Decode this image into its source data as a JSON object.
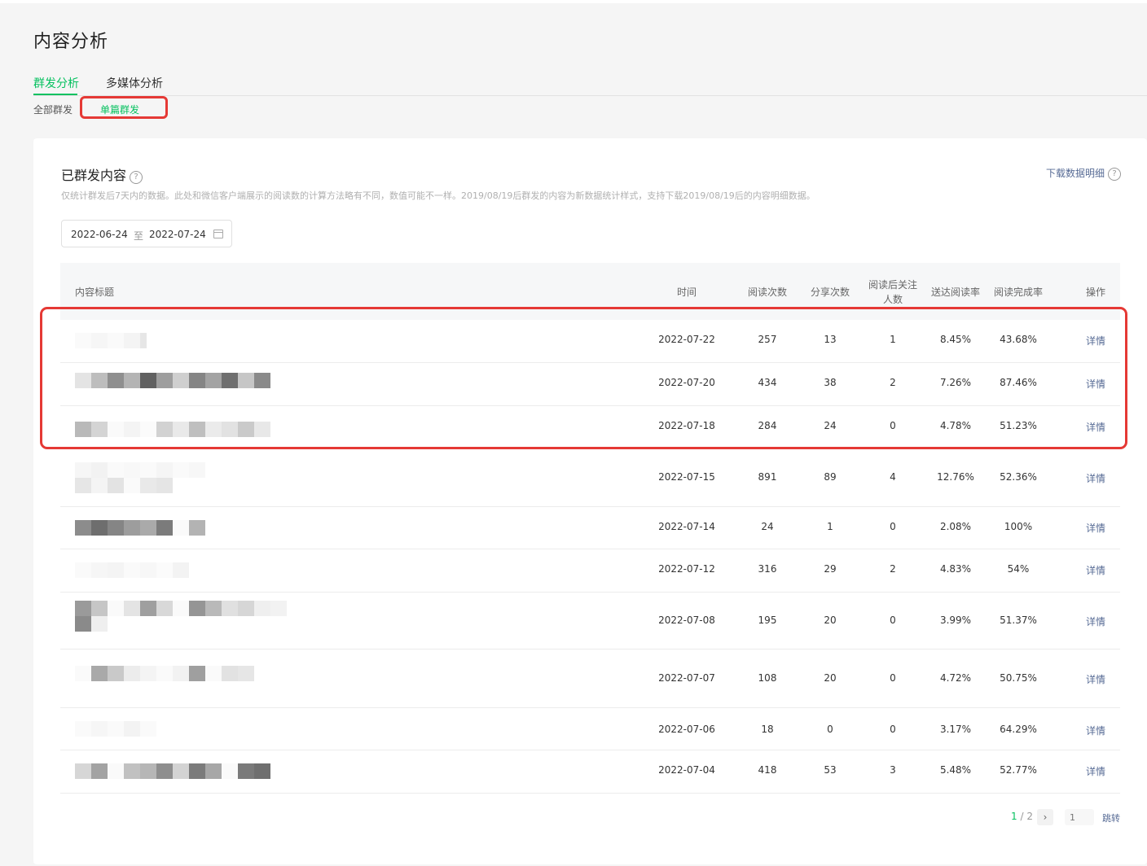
{
  "page": {
    "title": "内容分析"
  },
  "tabs": [
    {
      "label": "群发分析",
      "active": true
    },
    {
      "label": "多媒体分析",
      "active": false
    }
  ],
  "subtabs": [
    {
      "label": "全部群发",
      "active": false
    },
    {
      "label": "单篇群发",
      "active": true
    }
  ],
  "section": {
    "title": "已群发内容",
    "help_icon": "question-circle-icon",
    "description": "仅统计群发后7天内的数据。此处和微信客户端展示的阅读数的计算方法略有不同，数值可能不一样。2019/08/19后群发的内容为新数据统计样式，支持下载2019/08/19后的内容明细数据。",
    "download_label": "下载数据明细"
  },
  "date_range": {
    "start": "2022-06-24",
    "separator": "至",
    "end": "2022-07-24",
    "icon": "calendar-icon"
  },
  "table": {
    "headers": {
      "title": "内容标题",
      "time": "时间",
      "reads": "阅读次数",
      "shares": "分享次数",
      "follows_line1": "阅读后关注",
      "follows_line2": "人数",
      "delivery_rate": "送达阅读率",
      "completion_rate": "阅读完成率",
      "action": "操作"
    },
    "rows": [
      {
        "time": "2022-07-22",
        "reads": "257",
        "shares": "13",
        "follows": "1",
        "delivery_rate": "8.45%",
        "completion_rate": "43.68%",
        "action": "详情"
      },
      {
        "time": "2022-07-20",
        "reads": "434",
        "shares": "38",
        "follows": "2",
        "delivery_rate": "7.26%",
        "completion_rate": "87.46%",
        "action": "详情"
      },
      {
        "time": "2022-07-18",
        "reads": "284",
        "shares": "24",
        "follows": "0",
        "delivery_rate": "4.78%",
        "completion_rate": "51.23%",
        "action": "详情"
      },
      {
        "time": "2022-07-15",
        "reads": "891",
        "shares": "89",
        "follows": "4",
        "delivery_rate": "12.76%",
        "completion_rate": "52.36%",
        "action": "详情"
      },
      {
        "time": "2022-07-14",
        "reads": "24",
        "shares": "1",
        "follows": "0",
        "delivery_rate": "2.08%",
        "completion_rate": "100%",
        "action": "详情"
      },
      {
        "time": "2022-07-12",
        "reads": "316",
        "shares": "29",
        "follows": "2",
        "delivery_rate": "4.83%",
        "completion_rate": "54%",
        "action": "详情"
      },
      {
        "time": "2022-07-08",
        "reads": "195",
        "shares": "20",
        "follows": "0",
        "delivery_rate": "3.99%",
        "completion_rate": "51.37%",
        "action": "详情"
      },
      {
        "time": "2022-07-07",
        "reads": "108",
        "shares": "20",
        "follows": "0",
        "delivery_rate": "4.72%",
        "completion_rate": "50.75%",
        "action": "详情"
      },
      {
        "time": "2022-07-06",
        "reads": "18",
        "shares": "0",
        "follows": "0",
        "delivery_rate": "3.17%",
        "completion_rate": "64.29%",
        "action": "详情"
      },
      {
        "time": "2022-07-04",
        "reads": "418",
        "shares": "53",
        "follows": "3",
        "delivery_rate": "5.48%",
        "completion_rate": "52.77%",
        "action": "详情"
      }
    ]
  },
  "pagination": {
    "current": "1",
    "total": "/ 2",
    "next_icon": "chevron-right-icon",
    "input_placeholder": "1",
    "jump_label": "跳转"
  },
  "colors": {
    "accent": "#07c160",
    "link": "#576b95",
    "highlight": "#e53935"
  }
}
